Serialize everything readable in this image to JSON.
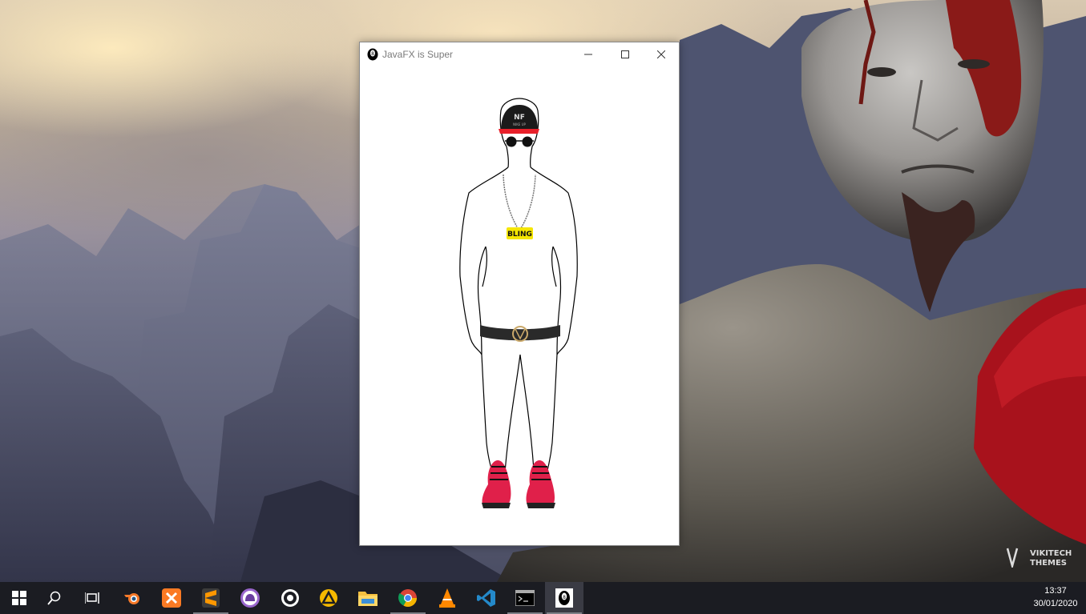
{
  "window": {
    "title": "JavaFX is Super",
    "icon": "eight-ball-icon"
  },
  "avatar": {
    "cap_text": "NF",
    "cap_subtext": "NIKE UP",
    "pendant_text": "BLING",
    "colors": {
      "cap_brim": "#e8202a",
      "cap_body": "#1a1a1a",
      "shoes": "#e0204a",
      "belt": "#2a2a2a",
      "pendant": "#f5e600"
    }
  },
  "wallpaper": {
    "watermark_line1": "VIKITECH",
    "watermark_line2": "THEMES"
  },
  "taskbar": {
    "items": [
      {
        "name": "start-button",
        "icon": "windows-icon"
      },
      {
        "name": "search-button",
        "icon": "search-icon"
      },
      {
        "name": "task-view-button",
        "icon": "task-view-icon"
      },
      {
        "name": "blender",
        "icon": "blender-icon"
      },
      {
        "name": "xampp",
        "icon": "xampp-icon"
      },
      {
        "name": "sublime-text",
        "icon": "sublime-icon"
      },
      {
        "name": "github-desktop",
        "icon": "github-icon"
      },
      {
        "name": "obs-studio",
        "icon": "obs-icon"
      },
      {
        "name": "arduino-like-app",
        "icon": "triangle-app-icon"
      },
      {
        "name": "file-explorer",
        "icon": "folder-icon"
      },
      {
        "name": "chrome",
        "icon": "chrome-icon"
      },
      {
        "name": "vlc",
        "icon": "vlc-icon"
      },
      {
        "name": "vscode",
        "icon": "vscode-icon"
      },
      {
        "name": "terminal",
        "icon": "terminal-icon"
      },
      {
        "name": "java-app",
        "icon": "eight-ball-icon"
      }
    ],
    "clock": {
      "time": "13:37",
      "date": "30/01/2020"
    }
  }
}
